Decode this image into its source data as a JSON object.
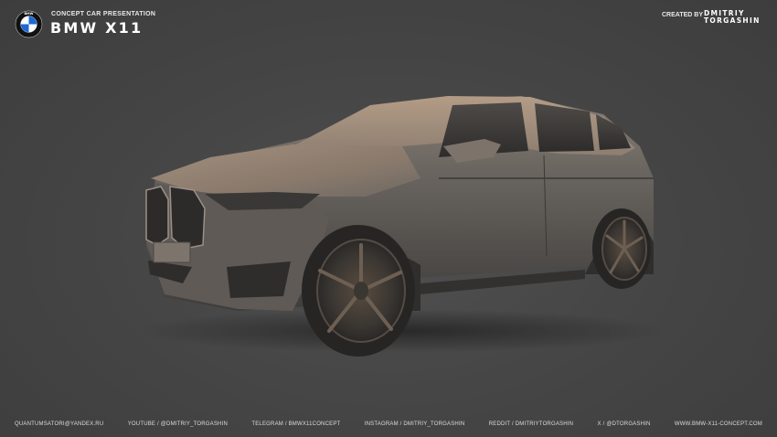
{
  "header": {
    "subtitle": "CONCEPT CAR PRESENTATION",
    "title": "BMW X11",
    "logo_letters": "BMW",
    "credit_label": "CREATED BY",
    "author_first": "DMITRIY",
    "author_last": "TORGASHIN"
  },
  "footer": {
    "links": [
      "QUANTUMSATORI@YANDEX.RU",
      "YOUTUBE / @DMITRIY_TORGASHIN",
      "TELEGRAM / BMWX11CONCEPT",
      "INSTAGRAM / DMITRIY_TORGASHIN",
      "REDDIT / DMITRIYTORGASHIN",
      "X / @DTORGASHIN",
      "WWW.BMW-X11-CONCEPT.COM"
    ]
  },
  "colors": {
    "background": "#464646",
    "text": "#f2f2f2",
    "logo_blue": "#1c69d4",
    "car_body": "#55524f"
  },
  "icons": [
    "bmw-logo-icon"
  ]
}
